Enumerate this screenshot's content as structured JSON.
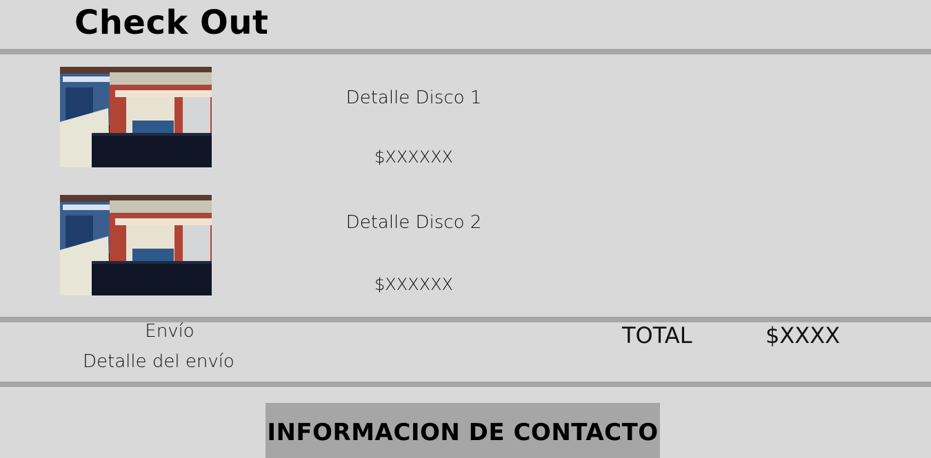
{
  "page": {
    "title": "Check Out"
  },
  "cart": {
    "items": [
      {
        "detail": "Detalle Disco 1",
        "price": "$XXXXXX",
        "image": "vinyl-records-photo"
      },
      {
        "detail": "Detalle Disco 2",
        "price": "$XXXXXX",
        "image": "vinyl-records-photo"
      }
    ]
  },
  "shipping": {
    "label": "Envío",
    "detail": "Detalle del envío"
  },
  "summary": {
    "total_label": "TOTAL",
    "total_value": "$XXXX"
  },
  "contact": {
    "button_label": "INFORMACION DE CONTACTO"
  },
  "colors": {
    "background": "#d9d9d9",
    "divider": "#a6a6a6",
    "button_bg": "#a6a6a6"
  }
}
